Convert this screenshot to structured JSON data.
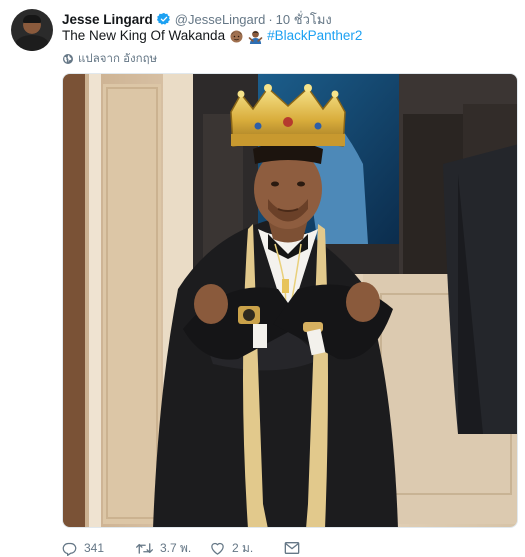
{
  "author": {
    "display_name": "Jesse Lingard",
    "handle": "@JesseLingard",
    "separator": "·",
    "time": "10 ชั่วโมง",
    "verified_icon": "verified-badge-icon"
  },
  "tweet": {
    "text": "The New King Of Wakanda",
    "hashtag": "#BlackPanther2",
    "emojis": [
      "man-face-emoji",
      "man-gesturing-emoji"
    ]
  },
  "translate": {
    "label": "แปลจาก อังกฤษ",
    "icon": "globe-icon"
  },
  "media": {
    "icon": "photo"
  },
  "actions": {
    "reply_count": "341",
    "retweet_count": "3.7 พ.",
    "like_count": "2 ม.",
    "icons": [
      "reply-icon",
      "retweet-icon",
      "like-icon",
      "message-icon"
    ]
  },
  "colors": {
    "accent": "#1da1f2",
    "secondary_text": "#657786",
    "primary_text": "#14171a"
  }
}
